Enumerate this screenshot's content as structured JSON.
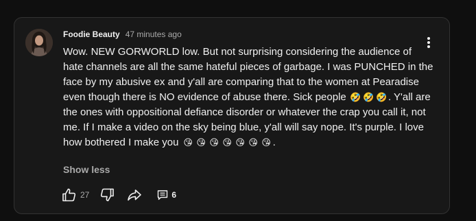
{
  "comment": {
    "author": "Foodie Beauty",
    "timestamp": "47 minutes ago",
    "text_part1": "Wow. NEW GORWORLD low. But not surprising considering the audience of hate channels are all the same hateful pieces of garbage. I was PUNCHED in the face by my abusive ex and y'all are comparing that to the women at Pearadise even though there is NO evidence of abuse there. Sick people ",
    "emoji_set1": [
      "🤣",
      "🤣",
      "🤣"
    ],
    "text_part2": ". Y'all are the ones with oppositional defiance disorder or whatever the crap you call it, not me. If I make a video on the sky being blue, y'all will say nope. It's purple. I love how bothered I make you ",
    "emoji_set2": [
      "😘",
      "😘",
      "😘",
      "😘",
      "😘",
      "😘",
      "😘"
    ],
    "text_part3": ".",
    "show_less_label": "Show less"
  },
  "actions": {
    "like_count": "27",
    "reply_count": "6"
  },
  "icons": {
    "like": "thumbs-up-icon",
    "dislike": "thumbs-down-icon",
    "share": "share-arrow-icon",
    "replies": "comment-bubble-icon",
    "menu": "more-vertical-icon"
  },
  "colors": {
    "background": "#0f0f0f",
    "card": "#181818",
    "text_primary": "#f1f1f1",
    "text_secondary": "#aaaaaa"
  }
}
